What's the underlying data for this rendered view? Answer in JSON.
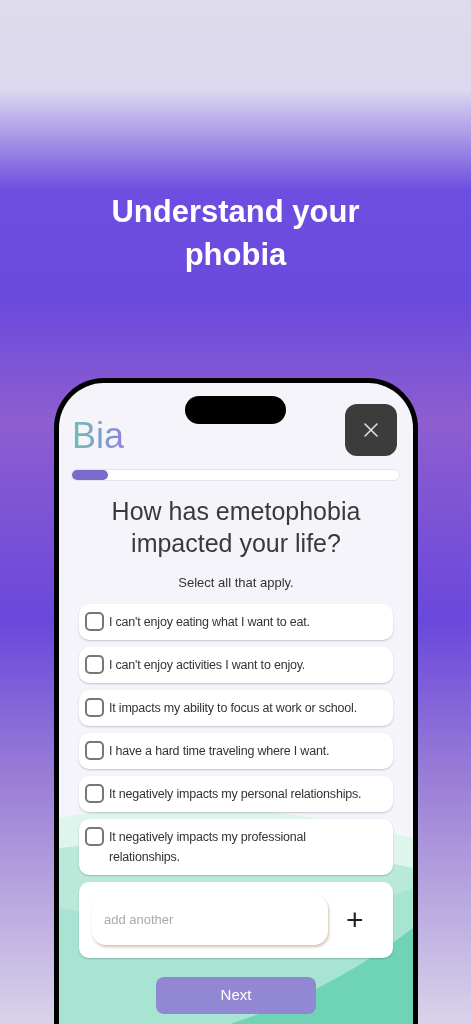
{
  "headline": "Understand your phobia",
  "logo": "Bia",
  "progress": {
    "level": 0.11
  },
  "question": "How has emetophobia impacted your life?",
  "subtitle": "Select all that apply.",
  "options": [
    {
      "label": "I can't enjoy eating what I want to eat.",
      "checked": false
    },
    {
      "label": "I can't enjoy activities I want to enjoy.",
      "checked": false
    },
    {
      "label": "It impacts my ability to focus at work or school.",
      "checked": false
    },
    {
      "label": "I have a hard time traveling where I want.",
      "checked": false
    },
    {
      "label": "It negatively impacts my personal relationships.",
      "checked": false
    },
    {
      "label": "It negatively impacts my professional relationships.",
      "checked": false
    }
  ],
  "add_field": {
    "placeholder": "add another",
    "button": "+"
  },
  "next_button": "Next"
}
